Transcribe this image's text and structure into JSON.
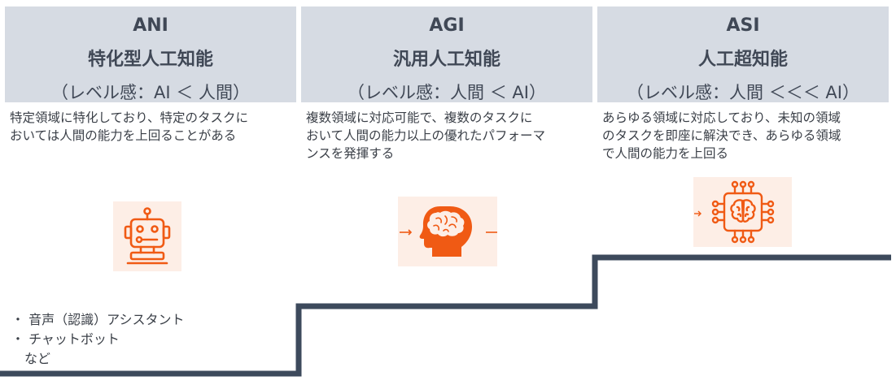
{
  "columns": [
    {
      "abbr": "ANI",
      "name": "特化型人工知能",
      "level": "（レベル感：AI ＜ 人間）",
      "description": "特定領域に特化しており、特定のタスクに\nおいては人間の能力を上回ることがある",
      "icon": "robot-icon"
    },
    {
      "abbr": "AGI",
      "name": "汎用人工知能",
      "level": "（レベル感：人間 ＜ AI）",
      "description": "複数領域に対応可能で、複数のタスクに\nおいて人間の能力以上の優れたパフォーマ\nンスを発揮する",
      "icon": "human-brain-icon"
    },
    {
      "abbr": "ASI",
      "name": "人工超知能",
      "level": "（レベル感：人間 ＜＜＜ AI）",
      "description": "あらゆる領域に対応しており、未知の領域\nのタスクを即座に解決でき、あらゆる領域\nで人間の能力を上回る",
      "icon": "brain-chip-icon"
    }
  ],
  "examples": {
    "items": [
      "・ 音声（認識）アシスタント",
      "・ チャットボット",
      "　など"
    ]
  },
  "colors": {
    "header_bg": "#d6dbe3",
    "icon_accent": "#f05a14",
    "icon_bg": "#fdeee6",
    "stair_line": "#3d4a5c"
  }
}
